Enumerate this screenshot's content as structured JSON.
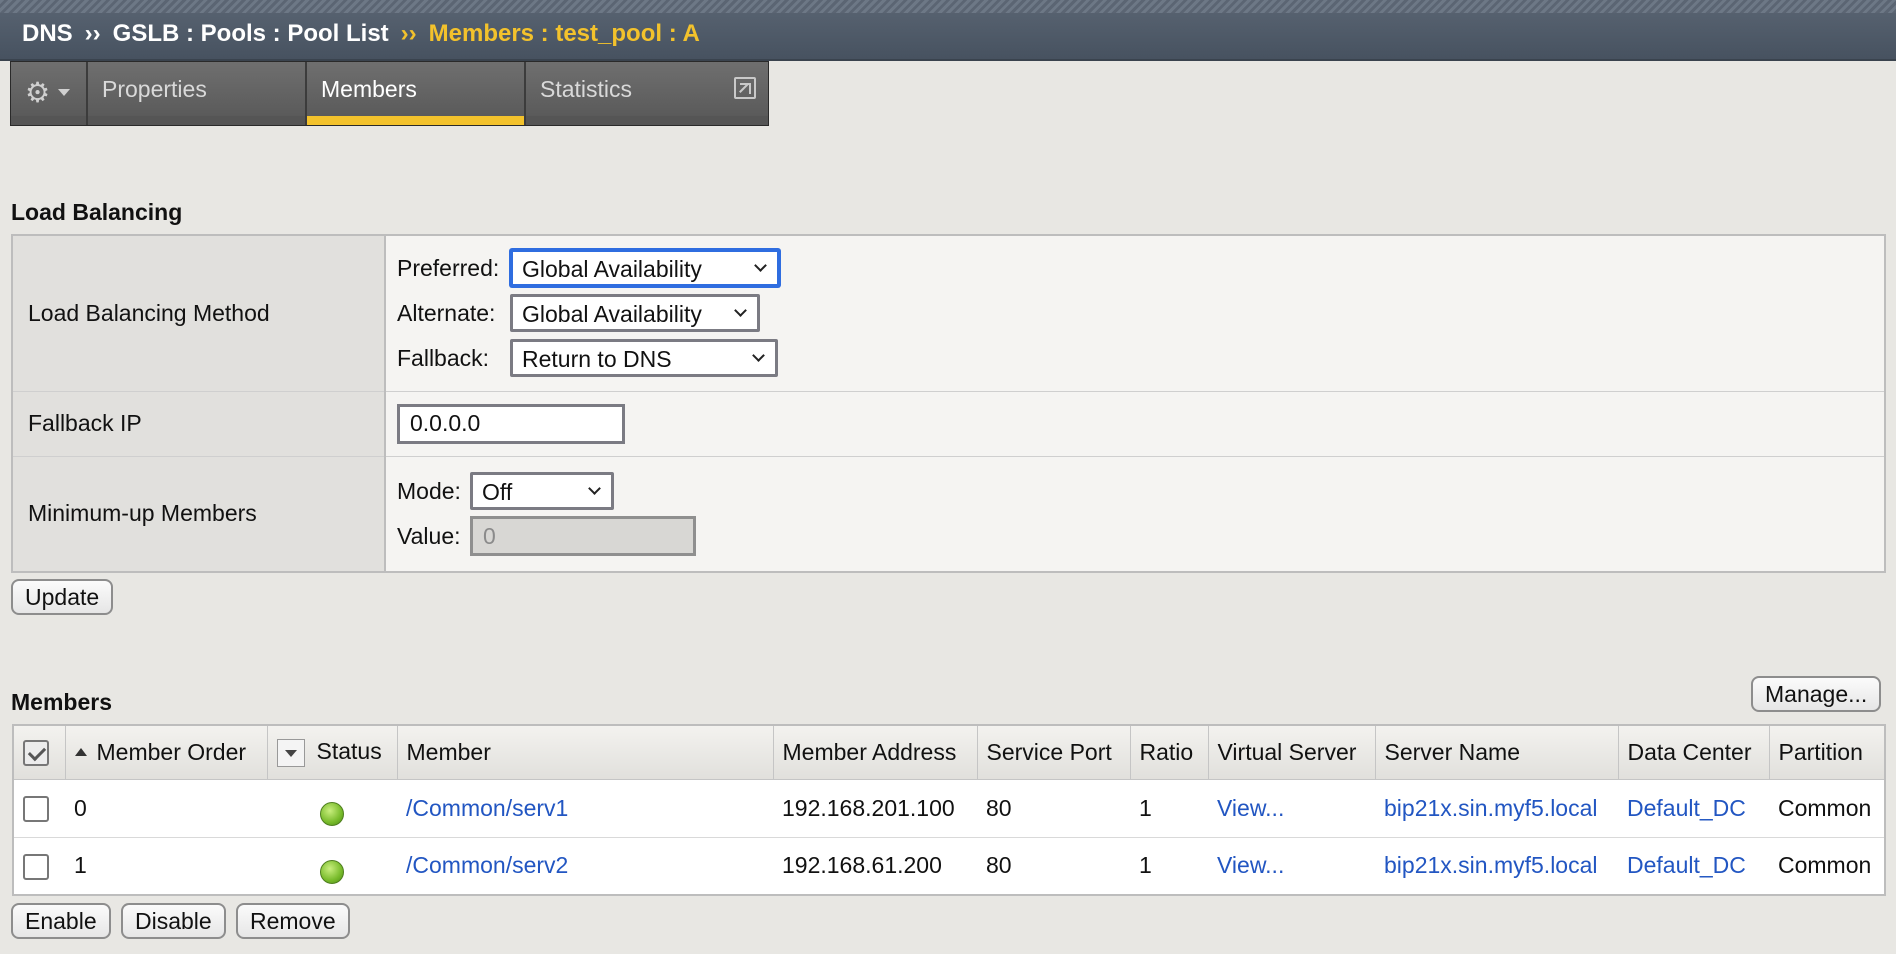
{
  "breadcrumb": {
    "root": "DNS",
    "path": "GSLB : Pools : Pool List",
    "current": "Members : test_pool : A",
    "separator": "››"
  },
  "tabs": [
    {
      "label": "Properties",
      "active": false
    },
    {
      "label": "Members",
      "active": true
    },
    {
      "label": "Statistics",
      "active": false
    }
  ],
  "load_balancing": {
    "title": "Load Balancing",
    "method_label": "Load Balancing Method",
    "preferred_label": "Preferred:",
    "preferred_value": "Global Availability",
    "alternate_label": "Alternate:",
    "alternate_value": "Global Availability",
    "fallback_label": "Fallback:",
    "fallback_value": "Return to DNS",
    "fallback_ip_label": "Fallback IP",
    "fallback_ip_value": "0.0.0.0",
    "min_up_label": "Minimum-up Members",
    "mode_label": "Mode:",
    "mode_value": "Off",
    "value_label": "Value:",
    "value_value": "0",
    "update_button": "Update"
  },
  "members": {
    "title": "Members",
    "manage_button": "Manage...",
    "columns": [
      "Member Order",
      "Status",
      "Member",
      "Member Address",
      "Service Port",
      "Ratio",
      "Virtual Server",
      "Server Name",
      "Data Center",
      "Partition"
    ],
    "rows": [
      {
        "order": "0",
        "status": "green",
        "member": "/Common/serv1",
        "address": "192.168.201.100",
        "port": "80",
        "ratio": "1",
        "virtual_server": "View...",
        "server_name": "bip21x.sin.myf5.local",
        "data_center": "Default_DC",
        "partition": "Common"
      },
      {
        "order": "1",
        "status": "green",
        "member": "/Common/serv2",
        "address": "192.168.61.200",
        "port": "80",
        "ratio": "1",
        "virtual_server": "View...",
        "server_name": "bip21x.sin.myf5.local",
        "data_center": "Default_DC",
        "partition": "Common"
      }
    ],
    "enable_button": "Enable",
    "disable_button": "Disable",
    "remove_button": "Remove"
  },
  "colors": {
    "accent": "#f3c22c",
    "link": "#2256c2",
    "status_ok": "#78bb2b"
  }
}
